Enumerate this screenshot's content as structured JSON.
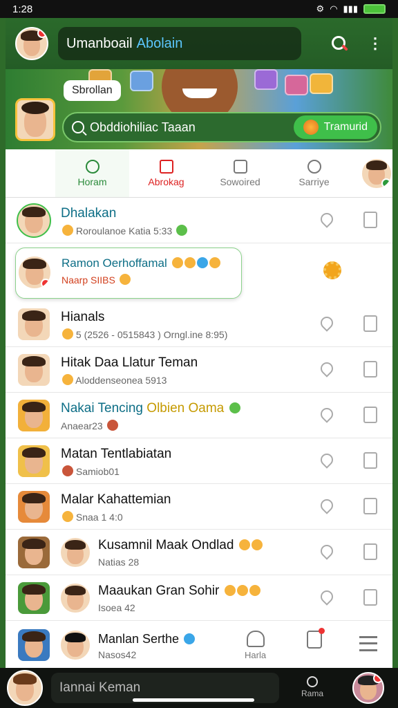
{
  "status": {
    "time": "1:28"
  },
  "header": {
    "title": "Umanboail",
    "title_accent": "Abolain"
  },
  "banner": {
    "bubble": "Sbrollan",
    "search_text": "Obddiohiliac Taaan",
    "button_label": "Tramurid"
  },
  "tabs": [
    {
      "label": "Horam",
      "state": "active"
    },
    {
      "label": "Abrokag",
      "state": "alert"
    },
    {
      "label": "Sowoired",
      "state": "normal"
    },
    {
      "label": "Sarriye",
      "state": "normal"
    }
  ],
  "rows": [
    {
      "name": "Dhalakan",
      "sub": "Roroulanoe  Katia 5:33"
    },
    {
      "name": "Ramon Oerhoffamal",
      "sub": "Naarp SIIBS"
    },
    {
      "name": "Hianals",
      "sub": "5  (2526 - 0515843  )   Orngl.ine 8:95)"
    },
    {
      "name": "Hitak Daa Llatur Teman",
      "sub": "Aloddenseonea 5913"
    },
    {
      "name": "Nakai Tencing",
      "name_accent": "Olbien Oama",
      "sub": "Anaear23"
    },
    {
      "name": "Matan Tentlabiatan",
      "sub": "Samiob01"
    },
    {
      "name": "Malar Kahattemian",
      "sub": "Snaa 1 4:0"
    },
    {
      "name": "Kusamnil Maak Ondlad",
      "sub": "Natias 28"
    },
    {
      "name": "Maaukan Gran Sohir",
      "sub": "Isoea 42"
    },
    {
      "name": "Manlan Serthe",
      "sub": "Nasos42"
    }
  ],
  "nav": {
    "home_label": "Harla",
    "search_label": "Rama"
  },
  "bottom": {
    "input_text": "Iannai Keman"
  },
  "colors": {
    "header_bg": "#245c26",
    "accent_green": "#2a8a3a",
    "alert_red": "#d22222",
    "title_accent": "#5cc7ff"
  }
}
